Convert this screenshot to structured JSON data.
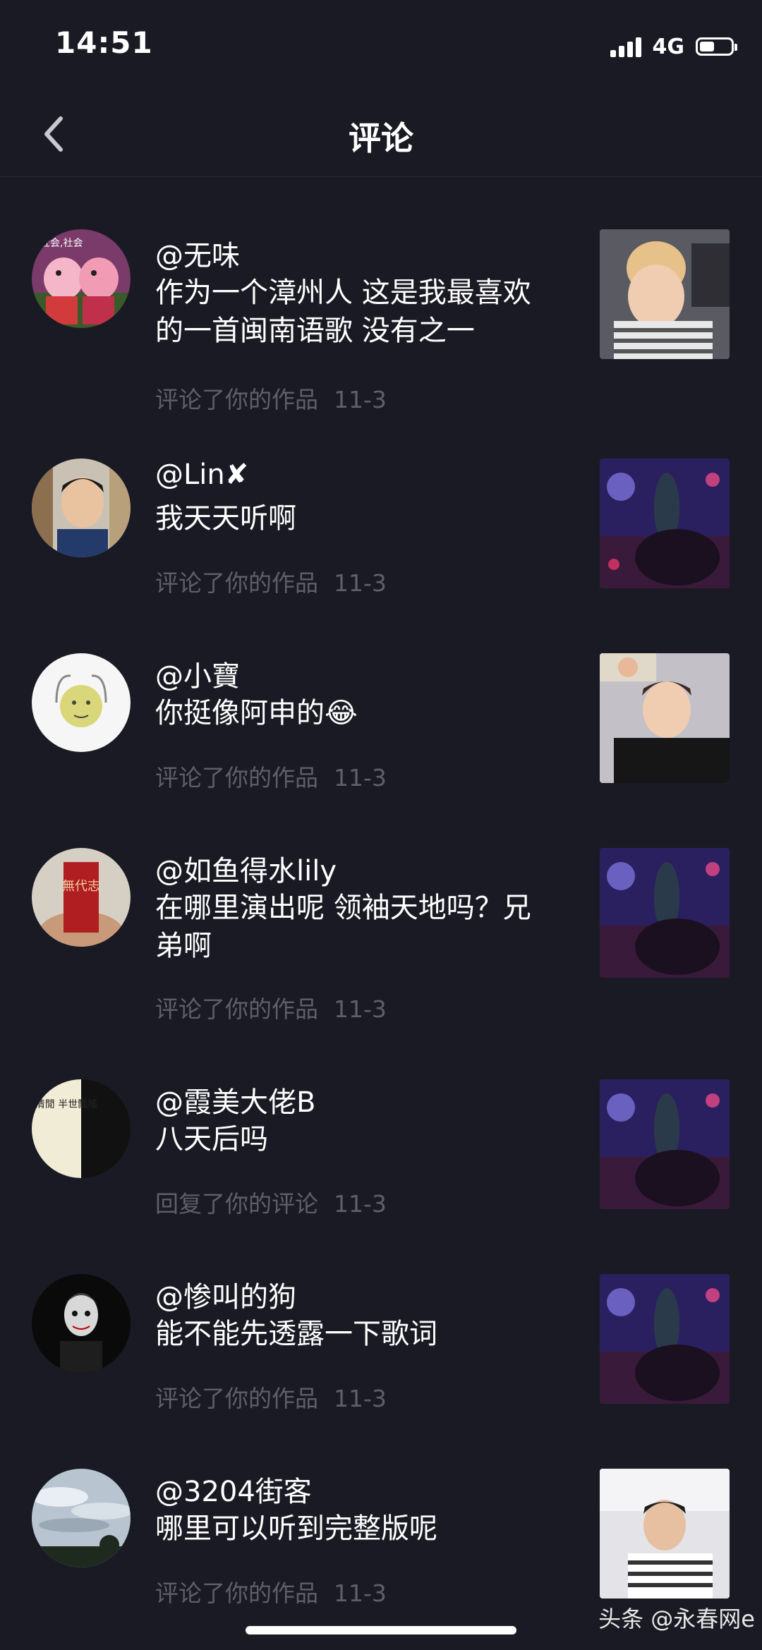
{
  "status": {
    "time": "14:51",
    "network": "4G"
  },
  "header": {
    "title": "评论",
    "back_icon": "chevron-left-icon"
  },
  "notifications": [
    {
      "username": "@无味",
      "comment": "作为一个漳州人 这是我最喜欢的一首闽南语歌 没有之一",
      "action": "评论了你的作品",
      "date": "11-3",
      "avatar_caption": "社会,社会"
    },
    {
      "username": "@Lin✘",
      "comment": "我天天听啊",
      "action": "评论了你的作品",
      "date": "11-3"
    },
    {
      "username": "@小寶",
      "comment": "你挺像阿申的😂",
      "action": "评论了你的作品",
      "date": "11-3"
    },
    {
      "username": "@如鱼得水lily",
      "comment": "在哪里演出呢 领袖天地吗？兄弟啊",
      "action": "评论了你的作品",
      "date": "11-3",
      "avatar_caption": "無代志"
    },
    {
      "username": "@霞美大佬B",
      "comment": "八天后吗",
      "action": "回复了你的评论",
      "date": "11-3",
      "avatar_caption": "半世清閒 半世飄搖"
    },
    {
      "username": "@惨叫的狗",
      "comment": "能不能先透露一下歌词",
      "action": "评论了你的作品",
      "date": "11-3"
    },
    {
      "username": "@3204街客",
      "comment": "哪里可以听到完整版呢",
      "action": "评论了你的作品",
      "date": "11-3"
    }
  ],
  "watermark": "头条 @永春网e"
}
